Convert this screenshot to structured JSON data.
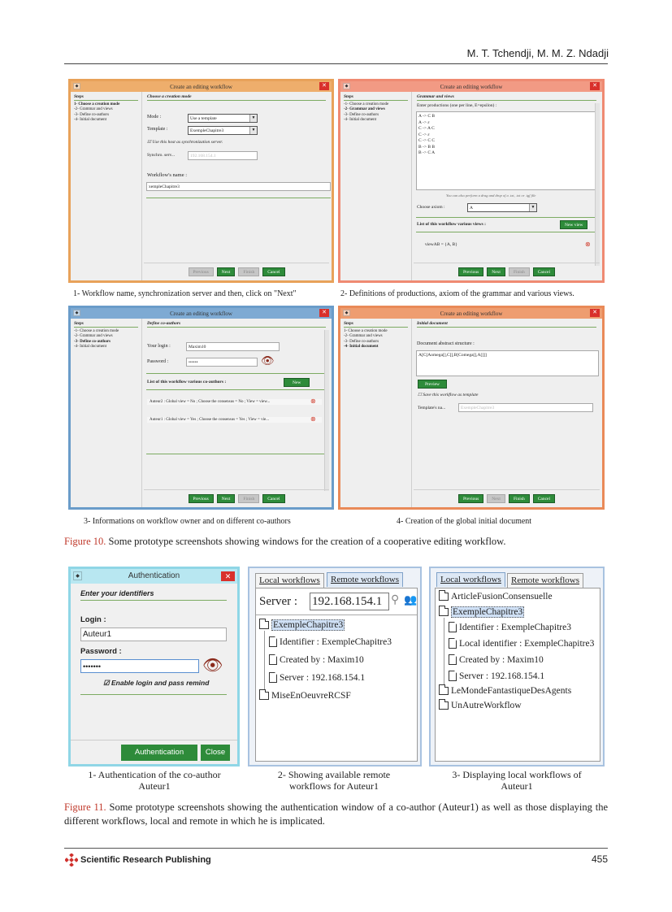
{
  "header": {
    "authors": "M. T. Tchendji, M. M. Z. Ndadji"
  },
  "windows": [
    {
      "title": "Create an editing workflow",
      "steps_heading": "Steps",
      "steps": [
        "1- Choose a creation mode",
        "-2- Grammar and views",
        "-3- Define co-authors",
        "-4- Initial document"
      ],
      "section": "Choose a creation mode",
      "mode_label": "Mode :",
      "mode_value": "Use a template",
      "template_label": "Template :",
      "template_value": "ExempleChapitre3",
      "checkbox_label": "Use this host as synchronization server.",
      "sync_label": "Synchro. serv...",
      "sync_value": "192.168.154.1",
      "name_label": "Workflow's name :",
      "name_value": "xempleChapitre3",
      "buttons": [
        "Previous",
        "Next",
        "Finish",
        "Cancel"
      ],
      "color": "#e8a25a"
    },
    {
      "title": "Create an editing workflow",
      "steps_heading": "Steps",
      "steps": [
        "-1- Choose a creation mode",
        "-2- Grammar and views",
        "-3- Define co-authors",
        "-4- Initial document"
      ],
      "section": "Grammar and views",
      "prod_label": "Enter productions (one per line, E=epsilon) :",
      "productions": [
        "A -> C B",
        "A -> ε",
        "C -> A C",
        "C -> ε",
        "C -> C C",
        "B -> B B",
        "B -> C A"
      ],
      "dnd_hint": "You can also perform a drag and drop of a .txt, .txt or .igf file",
      "axiom_label": "Choose axiom :",
      "axiom_value": "A",
      "views_label": "List of this workflow various views :",
      "new_view": "New view",
      "view_item": "viewAB = {A, B}",
      "buttons": [
        "Previous",
        "Next",
        "Finish",
        "Cancel"
      ],
      "color": "#ef8a72"
    },
    {
      "title": "Create an editing workflow",
      "steps_heading": "Steps",
      "steps": [
        "-1- Choose a creation mode",
        "-2- Grammar and views",
        "-3- Define co-authors",
        "-4- Initial document"
      ],
      "section": "Define co-authors",
      "login_label": "Your login :",
      "login_value": "Maxim10",
      "password_label": "Password :",
      "password_value": "••••••",
      "coauthors_label": "List of this workflow various co-authors :",
      "new_label": "New",
      "coauthors": [
        "Auteur2 : Global view = No ; Choose the consensus = No ; View = view...",
        "Auteur1 : Global view = Yes ; Choose the consensus = Yes ; View = vie..."
      ],
      "buttons": [
        "Previous",
        "Next",
        "Finish",
        "Cancel"
      ],
      "color": "#6a9cc9"
    },
    {
      "title": "Create an editing workflow",
      "steps_heading": "Steps",
      "steps": [
        "1- Choose a creation mode",
        "-2- Grammar and views",
        "-3- Define co-authors",
        "-4- Initial document"
      ],
      "section": "Initial document",
      "struct_label": "Document abstract structure :",
      "struct_value": "A[C[Aomega[],C[],B[Comega[],A[]]]",
      "preview": "Preview",
      "save_label": "Save this workflow as template",
      "template_label": "Template's na...",
      "template_value": "ExempleChapitre3",
      "buttons": [
        "Previous",
        "Next",
        "Finish",
        "Cancel"
      ],
      "color": "#e98a58"
    }
  ],
  "captions": {
    "c1": "1- Workflow name, synchronization server and then, click on \"Next\"",
    "c2": "2- Definitions of productions, axiom of the grammar and various views.",
    "c3": "3- Informations on workflow owner and on different co-authors",
    "c4": "4- Creation of the global initial document"
  },
  "figure10": {
    "label": "Figure 10.",
    "text": " Some prototype screenshots showing windows for the creation of a cooperative editing workflow."
  },
  "auth": {
    "title": "Authentication",
    "heading": "Enter your identifiers",
    "login_label": "Login :",
    "login_value": "Auteur1",
    "password_label": "Password :",
    "password_value": "•••••••",
    "remind_label": "Enable login and pass remind",
    "auth_button": "Authentication",
    "close_button": "Close"
  },
  "remote": {
    "tab_local": "Local workflows",
    "tab_remote": "Remote workflows",
    "server_label": "Server :",
    "server_value": "192.168.154.1",
    "items": [
      "ExempleChapitre3",
      "Identifier : ExempleChapitre3",
      "Created by : Maxim10",
      "Server : 192.168.154.1",
      "MiseEnOeuvreRCSF"
    ]
  },
  "local": {
    "tab_local": "Local workflows",
    "tab_remote": "Remote workflows",
    "items": [
      "ArticleFusionConsensuelle",
      "ExempleChapitre3",
      "Identifier : ExempleChapitre3",
      "Local identifier : ExempleChapitre3",
      "Created by : Maxim10",
      "Server : 192.168.154.1",
      "LeMondeFantastiqueDesAgents",
      "UnAutreWorkflow"
    ]
  },
  "bottom_captions": {
    "b1": "1- Authentication of the co-author Auteur1",
    "b2": "2- Showing available remote workflows for Auteur1",
    "b3": "3- Displaying local workflows of Auteur1"
  },
  "figure11": {
    "label": "Figure 11.",
    "text": " Some prototype screenshots showing the authentication window of a co-author (Auteur1) as well as those displaying the different workflows, local and remote in which he is implicated."
  },
  "footer": {
    "publisher": "Scientific Research Publishing",
    "page": "455"
  }
}
